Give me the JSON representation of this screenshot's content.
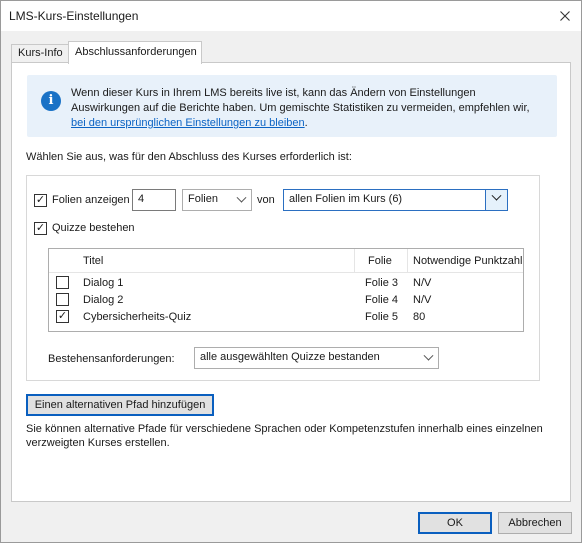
{
  "window": {
    "title": "LMS-Kurs-Einstellungen"
  },
  "tabs": [
    {
      "label": "Kurs-Info"
    },
    {
      "label": "Abschlussanforderungen"
    }
  ],
  "info": {
    "text": "Wenn dieser Kurs in Ihrem LMS bereits live ist, kann das Ändern von Einstellungen Auswirkungen auf die Berichte haben. Um gemischte Statistiken zu vermeiden, empfehlen wir, ",
    "link": "bei den ursprünglichen Einstellungen zu bleiben",
    "after": "."
  },
  "requirements": {
    "prompt": "Wählen Sie aus, was für den Abschluss des Kurses erforderlich ist:",
    "slides": {
      "checked": true,
      "label": "Folien anzeigen",
      "count": "4",
      "unit": "Folien",
      "of_label": "von",
      "scope": "allen Folien im Kurs (6)"
    },
    "quizzes": {
      "checked": true,
      "label": "Quizze bestehen",
      "columns": {
        "title": "Titel",
        "slide": "Folie",
        "score": "Notwendige Punktzahl"
      },
      "rows": [
        {
          "checked": false,
          "title": "Dialog 1",
          "slide": "Folie 3",
          "score": "N/V"
        },
        {
          "checked": false,
          "title": "Dialog 2",
          "slide": "Folie 4",
          "score": "N/V"
        },
        {
          "checked": true,
          "title": "Cybersicherheits-Quiz",
          "slide": "Folie 5",
          "score": "80"
        }
      ],
      "pass_label": "Bestehensanforderungen:",
      "pass_value": "alle ausgewählten Quizze bestanden"
    }
  },
  "alt_path": {
    "button": "Einen alternativen Pfad hinzufügen",
    "description": "Sie können alternative Pfade für verschiedene Sprachen oder Kompetenzstufen innerhalb eines einzelnen verzweigten Kurses erstellen."
  },
  "footer": {
    "ok": "OK",
    "cancel": "Abbrechen"
  }
}
